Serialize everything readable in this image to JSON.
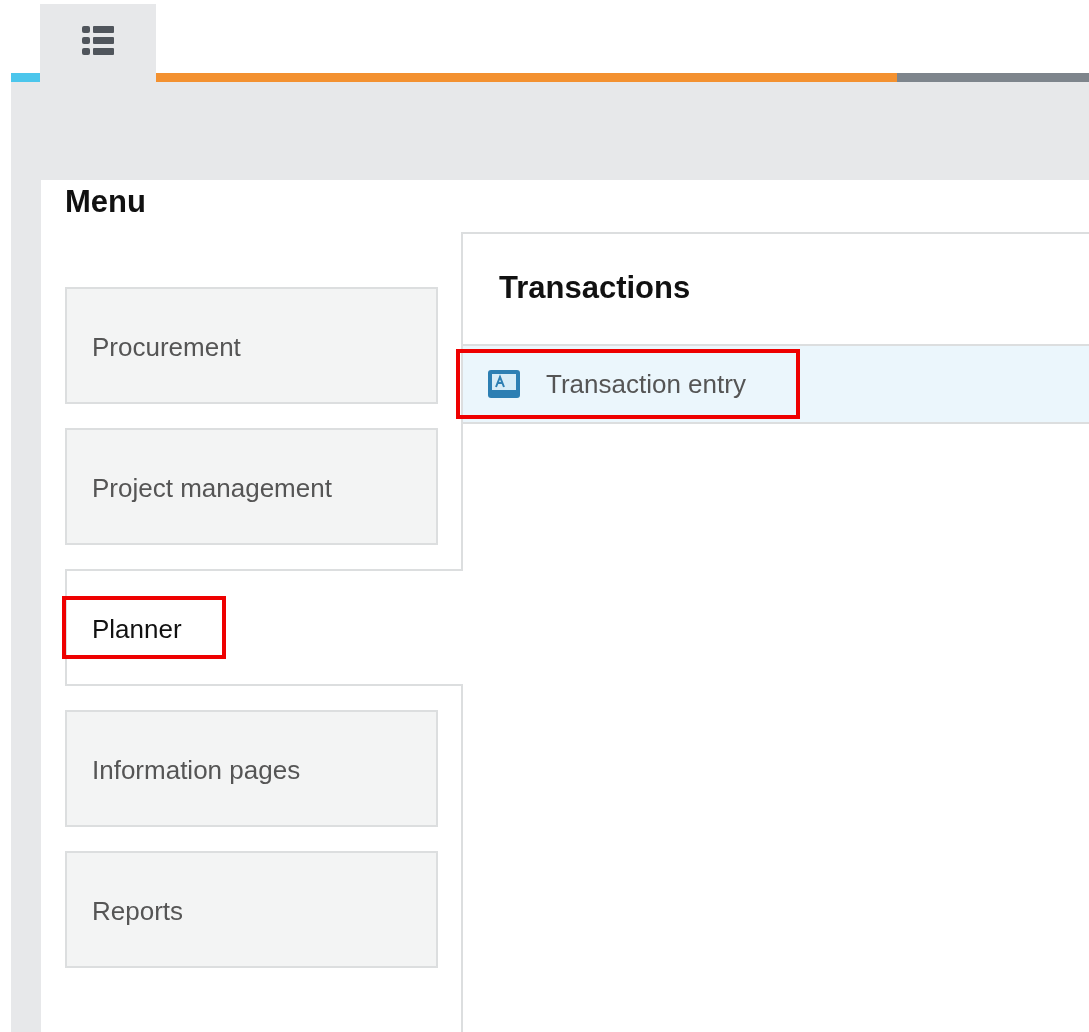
{
  "toolbar": {
    "tabs": [
      {
        "kind": "list",
        "selected": true
      }
    ]
  },
  "menu": {
    "title": "Menu",
    "items": [
      {
        "label": "Procurement",
        "selected": false,
        "annotated": false
      },
      {
        "label": "Project management",
        "selected": false,
        "annotated": false
      },
      {
        "label": "Planner",
        "selected": true,
        "annotated": true
      },
      {
        "label": "Information pages",
        "selected": false,
        "annotated": false
      },
      {
        "label": "Reports",
        "selected": false,
        "annotated": false
      }
    ]
  },
  "section": {
    "title": "Transactions",
    "rows": [
      {
        "label": "Transaction entry",
        "selected": true,
        "annotated": true
      }
    ]
  }
}
